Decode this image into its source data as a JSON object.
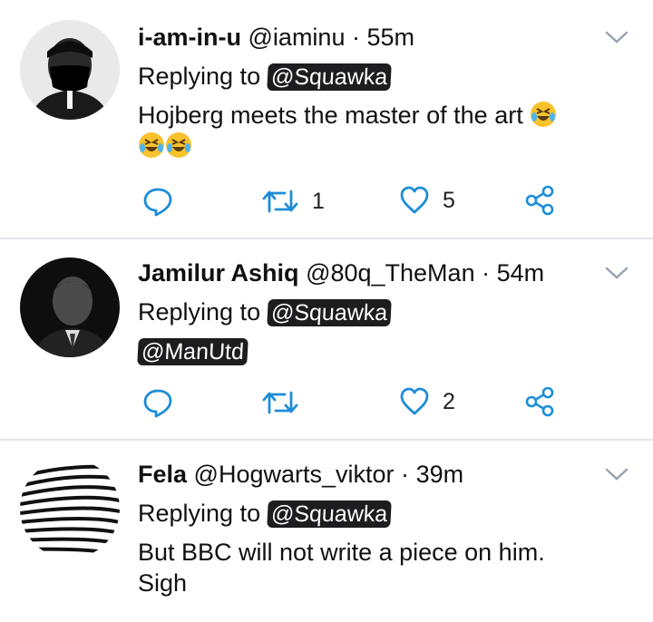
{
  "tweets": [
    {
      "name": "i-am-in-u",
      "handle": "@iaminu",
      "separator": "·",
      "time": "55m",
      "replying_prefix": "Replying to",
      "replying_to": "@Squawka",
      "text": "Hojberg meets the master of the art",
      "emoji": "rolling-on-floor-laughing",
      "reply_count": "",
      "retweet_count": "1",
      "like_count": "5"
    },
    {
      "name": "Jamilur Ashiq",
      "handle": "@80q_TheMan",
      "separator": "·",
      "time": "54m",
      "replying_prefix": "Replying to",
      "replying_to": "@Squawka",
      "mention": "@ManUtd",
      "reply_count": "",
      "retweet_count": "",
      "like_count": "2"
    },
    {
      "name": "Fela",
      "handle": "@Hogwarts_viktor",
      "separator": "·",
      "time": "39m",
      "replying_prefix": "Replying to",
      "replying_to": "@Squawka",
      "text_line1": "But BBC will not write a piece on him.",
      "text_line2": "Sigh"
    }
  ],
  "colors": {
    "icon": "#1d8dd8",
    "text": "#111111",
    "mention_bg": "#1d1d1f",
    "divider": "#e3e6e8"
  }
}
